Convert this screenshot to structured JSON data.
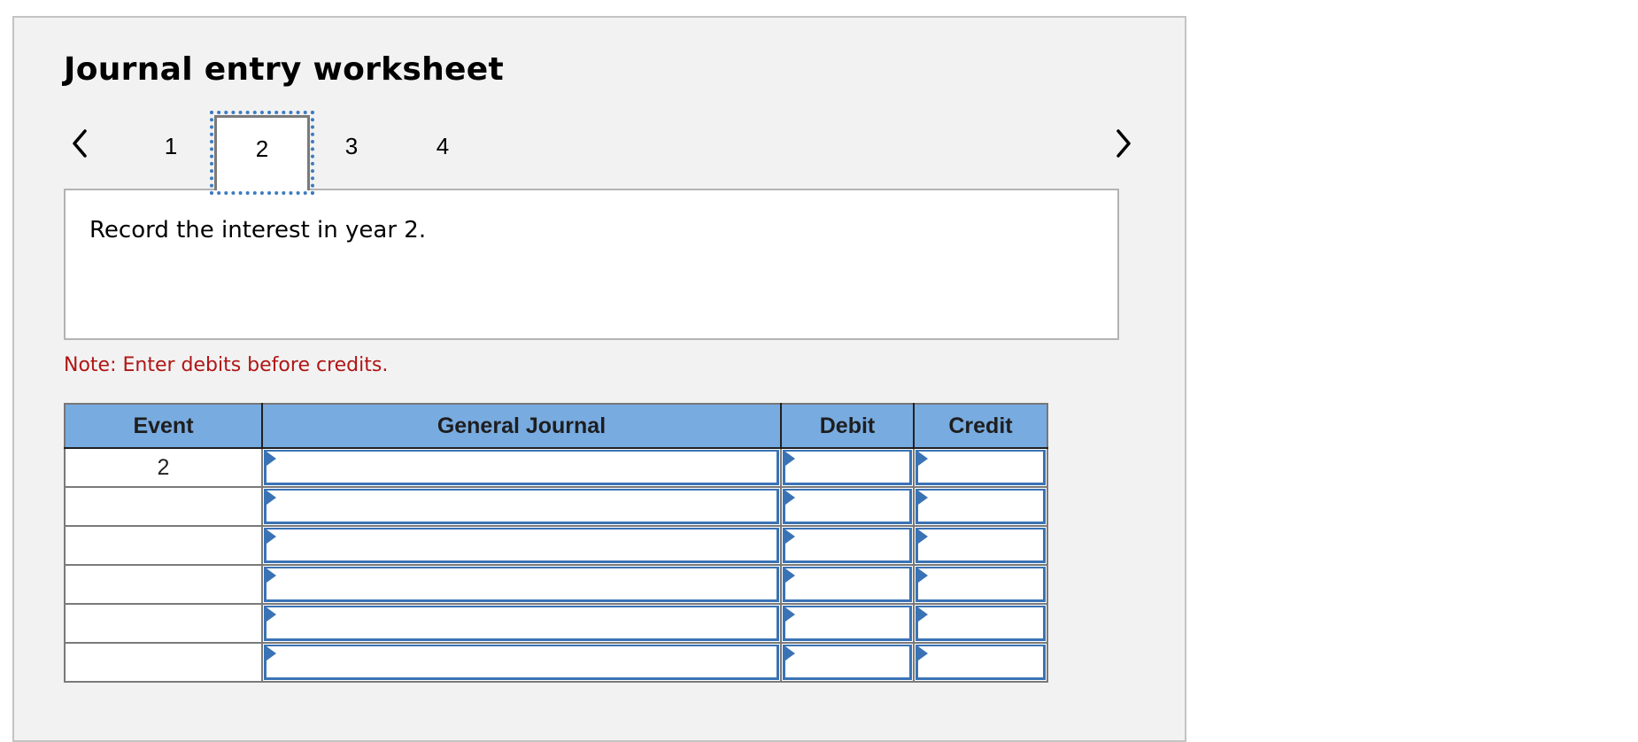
{
  "worksheet": {
    "title": "Journal entry worksheet",
    "nav": {
      "prev_icon": "chevron-left-icon",
      "next_icon": "chevron-right-icon",
      "tabs": [
        {
          "label": "1",
          "active": false
        },
        {
          "label": "2",
          "active": true
        },
        {
          "label": "3",
          "active": false
        },
        {
          "label": "4",
          "active": false
        }
      ]
    },
    "instruction": "Record the interest in year 2.",
    "note": "Note: Enter debits before credits.",
    "colors": {
      "header_bg": "#78abe0",
      "input_border": "#3a73b5",
      "note_text": "#b01515",
      "panel_bg": "#f2f2f2"
    }
  },
  "table": {
    "headers": {
      "event": "Event",
      "general_journal": "General Journal",
      "debit": "Debit",
      "credit": "Credit"
    },
    "rows": [
      {
        "event": "2",
        "account": "",
        "debit": "",
        "credit": ""
      },
      {
        "event": "",
        "account": "",
        "debit": "",
        "credit": ""
      },
      {
        "event": "",
        "account": "",
        "debit": "",
        "credit": ""
      },
      {
        "event": "",
        "account": "",
        "debit": "",
        "credit": ""
      },
      {
        "event": "",
        "account": "",
        "debit": "",
        "credit": ""
      },
      {
        "event": "",
        "account": "",
        "debit": "",
        "credit": ""
      }
    ]
  }
}
